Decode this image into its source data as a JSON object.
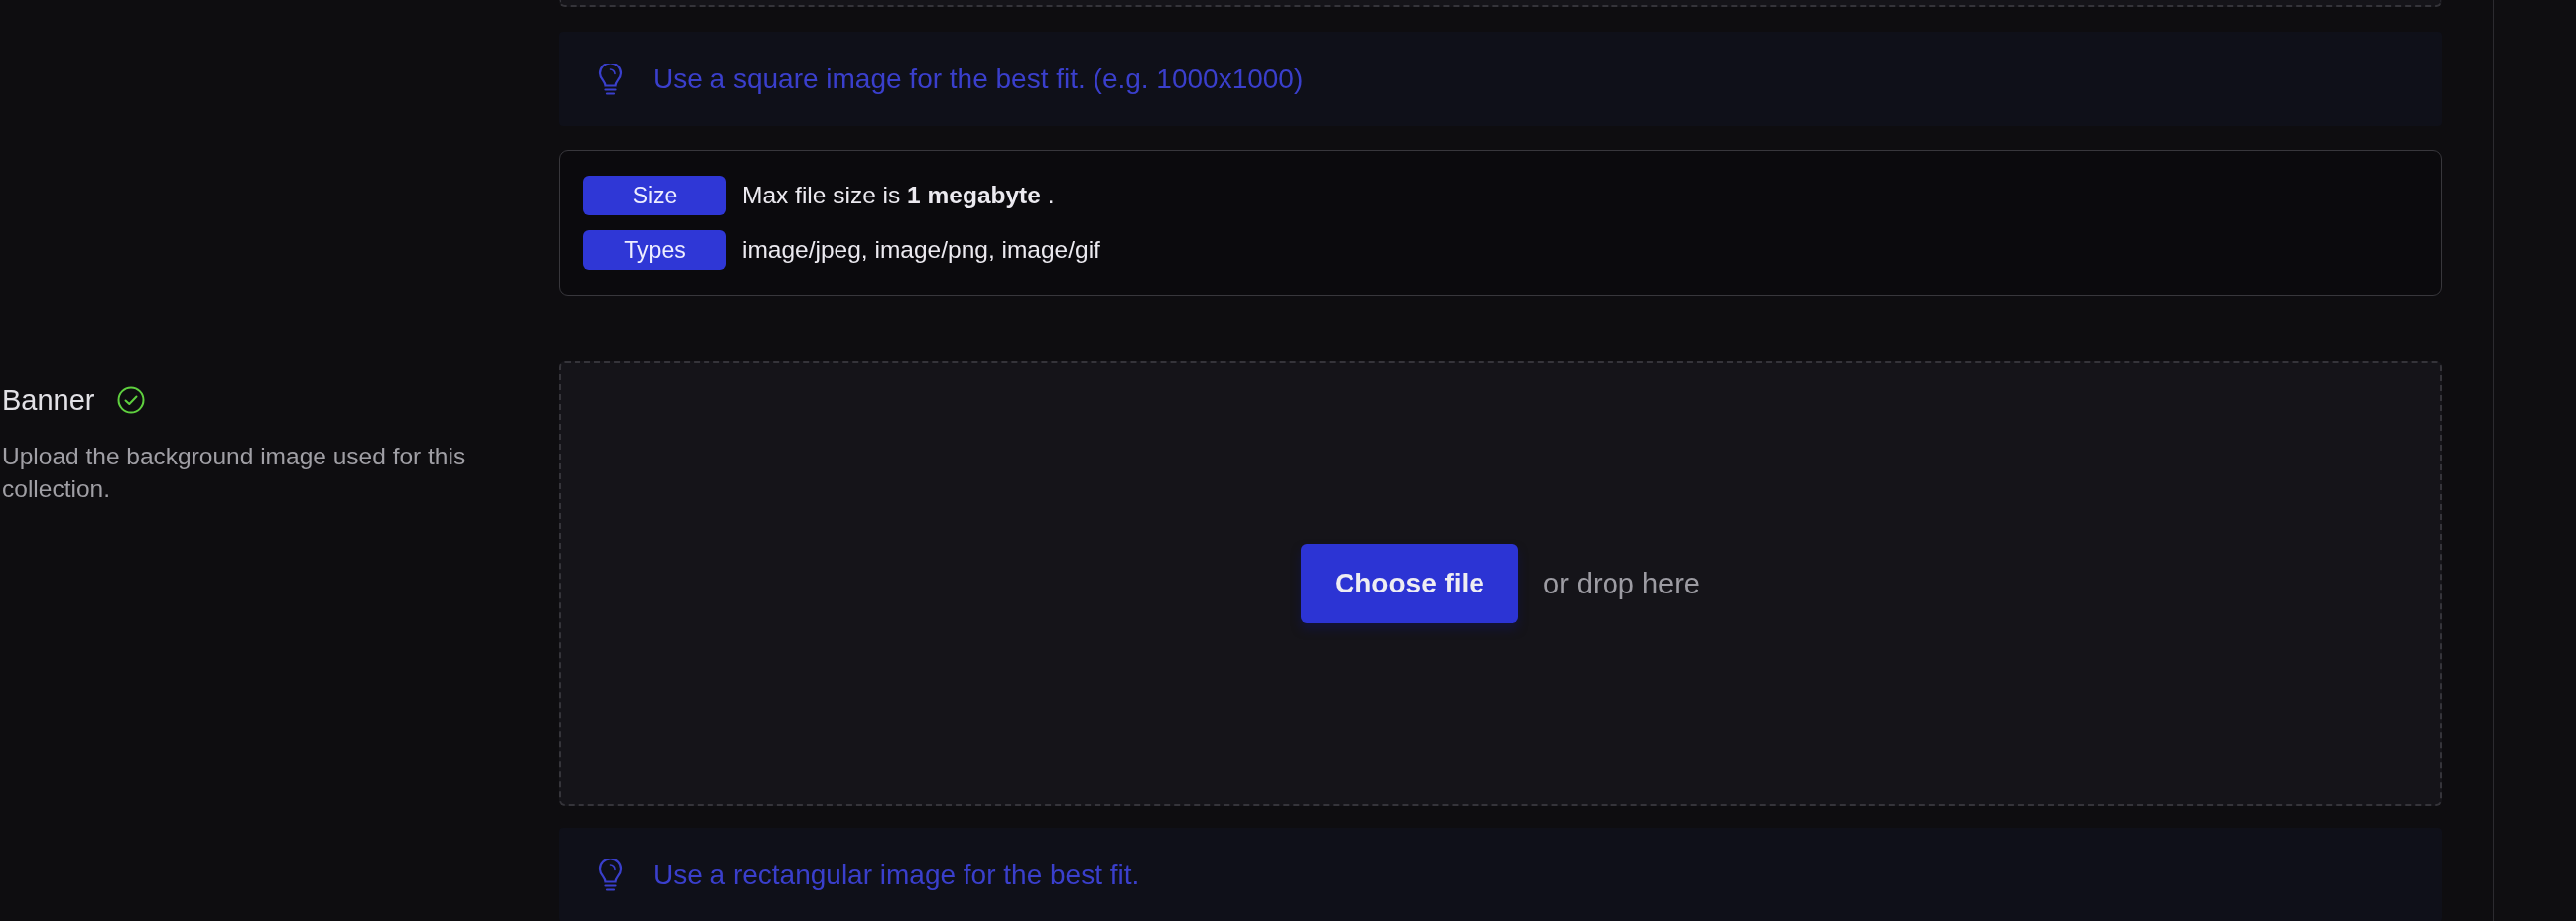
{
  "fields": [
    {
      "dropzone_edge": true,
      "tip": "Use a square image for the best fit. (e.g. 1000x1000)",
      "requirements": [
        {
          "label": "Size",
          "value": "Max file size is **1 megabyte** ."
        },
        {
          "label": "Types",
          "value": "image/jpeg, image/png, image/gif"
        }
      ]
    },
    {
      "title": "Banner",
      "valid": true,
      "description": "Upload the background image used for this collection.",
      "dropzone": {
        "button": "Choose file",
        "hint": "or drop here"
      },
      "tip": "Use a rectangular image for the best fit."
    }
  ]
}
